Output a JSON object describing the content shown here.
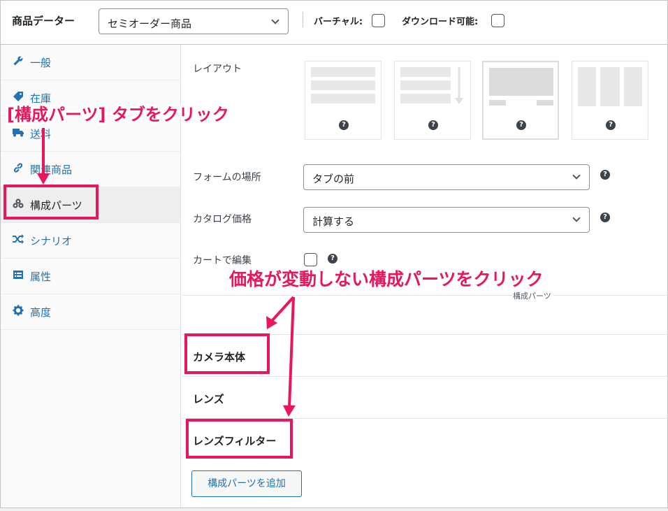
{
  "header": {
    "title": "商品データー",
    "product_type": "セミオーダー商品",
    "virtual_label": "バーチャル:",
    "downloadable_label": "ダウンロード可能:"
  },
  "sidebar": {
    "items": [
      {
        "label": "一般",
        "icon": "wrench-icon"
      },
      {
        "label": "在庫",
        "icon": "tag-icon"
      },
      {
        "label": "送料",
        "icon": "truck-icon"
      },
      {
        "label": "関連商品",
        "icon": "link-icon"
      },
      {
        "label": "構成パーツ",
        "icon": "components-icon"
      },
      {
        "label": "シナリオ",
        "icon": "shuffle-icon"
      },
      {
        "label": "属性",
        "icon": "list-icon"
      },
      {
        "label": "高度",
        "icon": "gear-icon"
      }
    ],
    "active": "構成パーツ"
  },
  "main": {
    "layout_label": "レイアウト",
    "form_location_label": "フォームの場所",
    "form_location_value": "タブの前",
    "catalog_price_label": "カタログ価格",
    "catalog_price_value": "計算する",
    "edit_in_cart_label": "カートで編集",
    "components_heading": "構成パーツ",
    "components": [
      "カメラ本体",
      "レンズ",
      "レンズフィルター"
    ],
    "add_button": "構成パーツを追加"
  },
  "annotations": {
    "tab_hint": "[構成パーツ] タブをクリック",
    "component_hint": "価格が変動しない構成パーツをクリック",
    "color": "#e8175d"
  }
}
